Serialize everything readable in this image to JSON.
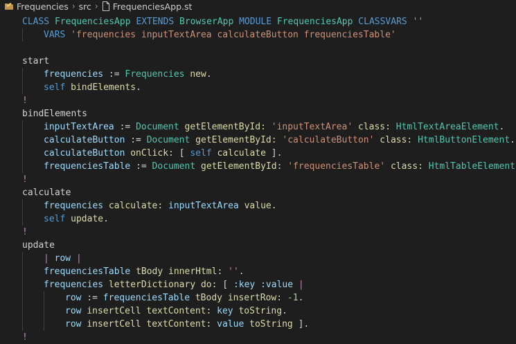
{
  "breadcrumb": {
    "items": [
      "Frequencies",
      "src",
      "FrequenciesApp.st"
    ]
  },
  "icons": {
    "folder": "folder-icon",
    "file": "file-icon",
    "separator": "chevron-right-icon"
  },
  "colors": {
    "background": "#1e1e1e",
    "keyword": "#569cd6",
    "string": "#ce9178",
    "variable": "#9cdcfe",
    "message": "#dcdcaa",
    "class": "#4ec9b0",
    "number": "#b5cea8",
    "bang": "#c586c0",
    "text": "#d4d4d4"
  },
  "code": {
    "lines": [
      {
        "indent": 0,
        "tokens": [
          [
            "kw",
            "CLASS "
          ],
          [
            "cls",
            "FrequenciesApp "
          ],
          [
            "kw",
            "EXTENDS "
          ],
          [
            "cls",
            "BrowserApp "
          ],
          [
            "kw",
            "MODULE "
          ],
          [
            "cls",
            "FrequenciesApp "
          ],
          [
            "kw",
            "CLASSVARS "
          ],
          [
            "str",
            "''"
          ]
        ]
      },
      {
        "indent": 1,
        "tokens": [
          [
            "kw",
            "VARS "
          ],
          [
            "str",
            "'frequencies inputTextArea calculateButton frequenciesTable'"
          ]
        ]
      },
      {
        "indent": 0,
        "tokens": []
      },
      {
        "indent": 0,
        "tokens": [
          [
            "plain",
            "start"
          ]
        ]
      },
      {
        "indent": 1,
        "tokens": [
          [
            "var",
            "frequencies "
          ],
          [
            "plain",
            ":= "
          ],
          [
            "cls",
            "Frequencies "
          ],
          [
            "msg",
            "new"
          ],
          [
            "plain",
            "."
          ]
        ]
      },
      {
        "indent": 1,
        "tokens": [
          [
            "kw",
            "self "
          ],
          [
            "msg",
            "bindElements"
          ],
          [
            "plain",
            "."
          ]
        ]
      },
      {
        "indent": 0,
        "tokens": [
          [
            "bang",
            "!"
          ]
        ]
      },
      {
        "indent": 0,
        "tokens": [
          [
            "plain",
            "bindElements"
          ]
        ]
      },
      {
        "indent": 1,
        "tokens": [
          [
            "var",
            "inputTextArea "
          ],
          [
            "plain",
            ":= "
          ],
          [
            "cls",
            "Document "
          ],
          [
            "msg",
            "getElementById: "
          ],
          [
            "str",
            "'inputTextArea' "
          ],
          [
            "msg",
            "class: "
          ],
          [
            "cls",
            "HtmlTextAreaElement"
          ],
          [
            "plain",
            "."
          ]
        ]
      },
      {
        "indent": 1,
        "tokens": [
          [
            "var",
            "calculateButton "
          ],
          [
            "plain",
            ":= "
          ],
          [
            "cls",
            "Document "
          ],
          [
            "msg",
            "getElementById: "
          ],
          [
            "str",
            "'calculateButton' "
          ],
          [
            "msg",
            "class: "
          ],
          [
            "cls",
            "HtmlButtonElement"
          ],
          [
            "plain",
            "."
          ]
        ]
      },
      {
        "indent": 1,
        "tokens": [
          [
            "var",
            "calculateButton "
          ],
          [
            "msg",
            "onClick: "
          ],
          [
            "plain",
            "[ "
          ],
          [
            "kw",
            "self "
          ],
          [
            "msg",
            "calculate "
          ],
          [
            "plain",
            "]."
          ]
        ]
      },
      {
        "indent": 1,
        "tokens": [
          [
            "var",
            "frequenciesTable "
          ],
          [
            "plain",
            ":= "
          ],
          [
            "cls",
            "Document "
          ],
          [
            "msg",
            "getElementById: "
          ],
          [
            "str",
            "'frequenciesTable' "
          ],
          [
            "msg",
            "class: "
          ],
          [
            "cls",
            "HtmlTableElement"
          ],
          [
            "plain",
            "."
          ]
        ]
      },
      {
        "indent": 0,
        "tokens": [
          [
            "bang",
            "!"
          ]
        ]
      },
      {
        "indent": 0,
        "tokens": [
          [
            "plain",
            "calculate"
          ]
        ]
      },
      {
        "indent": 1,
        "tokens": [
          [
            "var",
            "frequencies "
          ],
          [
            "msg",
            "calculate: "
          ],
          [
            "var",
            "inputTextArea "
          ],
          [
            "msg",
            "value"
          ],
          [
            "plain",
            "."
          ]
        ]
      },
      {
        "indent": 1,
        "tokens": [
          [
            "kw",
            "self "
          ],
          [
            "msg",
            "update"
          ],
          [
            "plain",
            "."
          ]
        ]
      },
      {
        "indent": 0,
        "tokens": [
          [
            "bang",
            "!"
          ]
        ]
      },
      {
        "indent": 0,
        "tokens": [
          [
            "plain",
            "update"
          ]
        ]
      },
      {
        "indent": 1,
        "tokens": [
          [
            "pipe",
            "| "
          ],
          [
            "var",
            "row "
          ],
          [
            "pipe",
            "|"
          ]
        ]
      },
      {
        "indent": 1,
        "tokens": [
          [
            "var",
            "frequenciesTable "
          ],
          [
            "msg",
            "tBody innerHtml: "
          ],
          [
            "str",
            "''"
          ],
          [
            "plain",
            "."
          ]
        ]
      },
      {
        "indent": 1,
        "tokens": [
          [
            "var",
            "frequencies "
          ],
          [
            "msg",
            "letterDictionary do: "
          ],
          [
            "plain",
            "[ "
          ],
          [
            "var",
            ":key :value "
          ],
          [
            "pipe",
            "|"
          ]
        ]
      },
      {
        "indent": 2,
        "tokens": [
          [
            "var",
            "row "
          ],
          [
            "plain",
            ":= "
          ],
          [
            "var",
            "frequenciesTable "
          ],
          [
            "msg",
            "tBody insertRow: "
          ],
          [
            "num",
            "-1"
          ],
          [
            "plain",
            "."
          ]
        ]
      },
      {
        "indent": 2,
        "tokens": [
          [
            "var",
            "row "
          ],
          [
            "msg",
            "insertCell textContent: "
          ],
          [
            "var",
            "key "
          ],
          [
            "msg",
            "toString"
          ],
          [
            "plain",
            "."
          ]
        ]
      },
      {
        "indent": 2,
        "tokens": [
          [
            "var",
            "row "
          ],
          [
            "msg",
            "insertCell textContent: "
          ],
          [
            "var",
            "value "
          ],
          [
            "msg",
            "toString "
          ],
          [
            "plain",
            "]."
          ]
        ]
      },
      {
        "indent": 0,
        "tokens": [
          [
            "bang",
            "!"
          ]
        ]
      }
    ]
  }
}
